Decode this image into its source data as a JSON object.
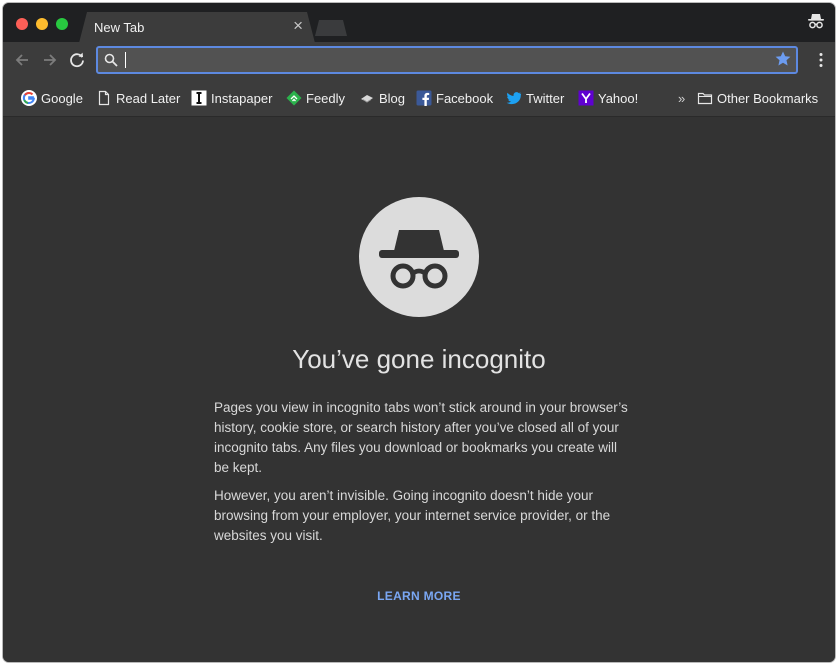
{
  "tab": {
    "title": "New Tab",
    "close": "×"
  },
  "omnibox": {
    "value": "",
    "placeholder": ""
  },
  "bookmarks": [
    {
      "label": "Google",
      "icon": "google-icon"
    },
    {
      "label": "Read Later",
      "icon": "page-icon"
    },
    {
      "label": "Instapaper",
      "icon": "instapaper-icon"
    },
    {
      "label": "Feedly",
      "icon": "feedly-icon"
    },
    {
      "label": "Blog",
      "icon": "blog-icon"
    },
    {
      "label": "Facebook",
      "icon": "facebook-icon"
    },
    {
      "label": "Twitter",
      "icon": "twitter-icon"
    },
    {
      "label": "Yahoo!",
      "icon": "yahoo-icon"
    }
  ],
  "bookmarks_overflow": "»",
  "other_bookmarks": "Other Bookmarks",
  "page": {
    "heading": "You’ve gone incognito",
    "paragraph1": "Pages you view in incognito tabs won’t stick around in your browser’s history, cookie store, or search history after you’ve closed all of your incognito tabs. Any files you download or bookmarks you create will be kept.",
    "paragraph2": "However, you aren’t invisible. Going incognito doesn’t hide your browsing from your employer, your internet service provider, or the websites you visit.",
    "learn_more": "LEARN MORE"
  },
  "colors": {
    "titlebar": "#1f2022",
    "toolbar": "#3c3c3c",
    "content_bg": "#333333",
    "accent": "#5d89e0",
    "link": "#7aa7f3"
  }
}
